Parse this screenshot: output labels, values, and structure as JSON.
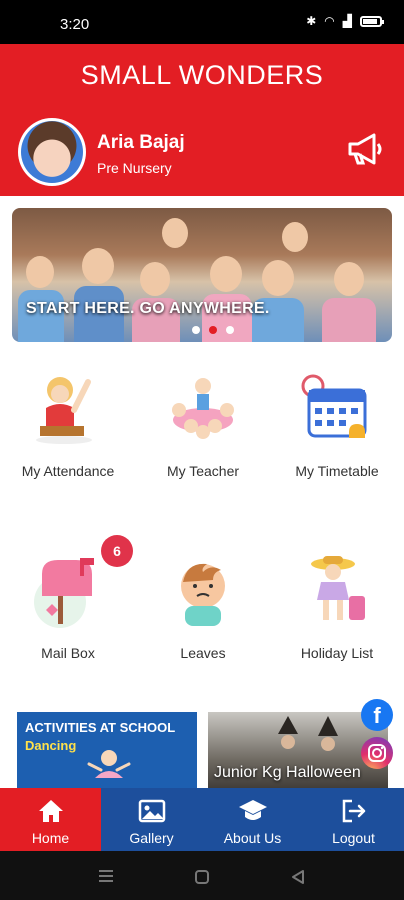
{
  "status_bar": {
    "time": "3:20",
    "battery_level": 0.85
  },
  "header": {
    "app_title": "SMALL WONDERS",
    "student_name": "Aria Bajaj",
    "student_class": "Pre Nursery"
  },
  "banner": {
    "caption": "START HERE. GO ANYWHERE.",
    "slide_count": 3,
    "active_slide": 2
  },
  "menu": {
    "items": [
      {
        "label": "My Attendance",
        "icon": "attendance-icon"
      },
      {
        "label": "My Teacher",
        "icon": "teacher-icon"
      },
      {
        "label": "My Timetable",
        "icon": "calendar-icon"
      },
      {
        "label": "Mail Box",
        "icon": "mailbox-icon",
        "badge": "6"
      },
      {
        "label": "Leaves",
        "icon": "leaves-icon"
      },
      {
        "label": "Holiday List",
        "icon": "holiday-icon"
      }
    ]
  },
  "promos": {
    "activities": {
      "title": "ACTIVITIES AT SCHOOL",
      "subtitle": "Dancing"
    },
    "event": {
      "title": "Junior Kg Halloween"
    }
  },
  "social": [
    "facebook-icon",
    "instagram-icon"
  ],
  "bottom_nav": {
    "items": [
      {
        "label": "Home",
        "icon": "home-icon",
        "active": true
      },
      {
        "label": "Gallery",
        "icon": "gallery-icon"
      },
      {
        "label": "About Us",
        "icon": "graduation-cap-icon"
      },
      {
        "label": "Logout",
        "icon": "logout-icon"
      }
    ]
  },
  "colors": {
    "primary_red": "#e31e24",
    "nav_blue": "#1d4f9c",
    "badge": "#e0334a"
  }
}
